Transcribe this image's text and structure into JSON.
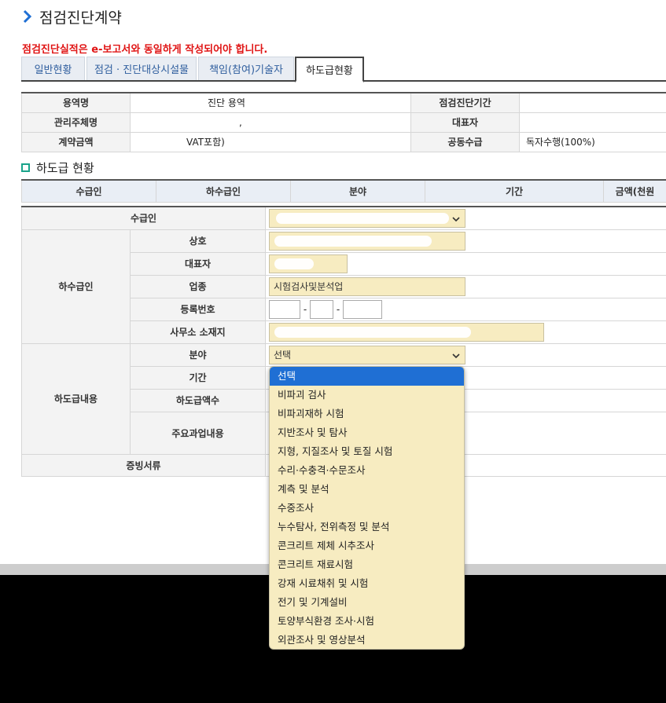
{
  "page": {
    "title": "점검진단계약",
    "notice": "점검진단실적은 e-보고서와 동일하게 작성되어야 합니다."
  },
  "tabs": [
    {
      "label": "일반현황"
    },
    {
      "label": "점검 · 진단대상시설물"
    },
    {
      "label": "책임(참여)기술자"
    },
    {
      "label": "하도급현황"
    }
  ],
  "info": {
    "service_label": "용역명",
    "service_value": "진단 용역",
    "period_label": "점검진단기간",
    "period_value": "",
    "manager_label": "관리주체명",
    "manager_value": ",",
    "rep_label": "대표자",
    "rep_value": "",
    "amount_label": "계약금액",
    "amount_value": "VAT포함)",
    "joint_label": "공동수급",
    "joint_value": "독자수행(100%)"
  },
  "section": {
    "title": "하도급 현황"
  },
  "list_headers": [
    "수급인",
    "하수급인",
    "분야",
    "기간",
    "금액(천원"
  ],
  "form": {
    "contractor_label": "수급인",
    "subcontractor_group": "하수급인",
    "name_label": "상호",
    "rep_label": "대표자",
    "business_label": "업종",
    "business_value": "시험검사및분석업",
    "regno_label": "등록번호",
    "regno_sep": "-",
    "address_label": "사무소 소재지",
    "content_group": "하도급내용",
    "field_label": "분야",
    "field_value": "선택",
    "period_label": "기간",
    "amount_label": "하도급액수",
    "work_label": "주요과업내용",
    "docs_label": "증빙서류"
  },
  "dropdown": {
    "options": [
      "선택",
      "비파괴 검사",
      "비파괴재하 시험",
      "지반조사 및 탐사",
      "지형, 지질조사 및 토질 시험",
      "수리·수충격·수문조사",
      "계측 및 분석",
      "수중조사",
      "누수탐사, 전위측정 및 분석",
      "콘크리트 제체 시추조사",
      "콘크리트 재료시험",
      "강재 시료채취 및 시험",
      "전기 및 기계설비",
      "토양부식환경 조사·시험",
      "외관조사 및 영상분석"
    ],
    "highlighted": "선택"
  },
  "colors": {
    "accent": "#1f6fd4",
    "notice": "#e01414",
    "input_bg": "#f7ecc1",
    "section_icon": "#1aa38a"
  }
}
